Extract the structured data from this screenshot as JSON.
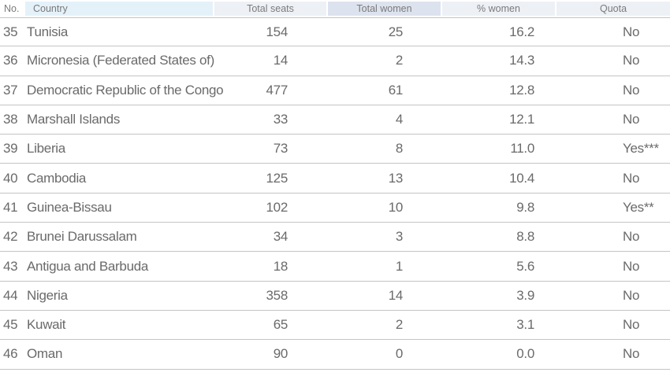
{
  "header": {
    "no": "No.",
    "country": "Country",
    "total_seats": "Total seats",
    "total_women": "Total women",
    "pct_women": "% women",
    "quota": "Quota"
  },
  "rows": [
    {
      "no": "35",
      "country": "Tunisia",
      "seats": "154",
      "women": "25",
      "pct": "16.2",
      "quota": "No"
    },
    {
      "no": "36",
      "country": "Micronesia (Federated States of)",
      "seats": "14",
      "women": "2",
      "pct": "14.3",
      "quota": "No"
    },
    {
      "no": "37",
      "country": "Democratic Republic of the Congo",
      "seats": "477",
      "women": "61",
      "pct": "12.8",
      "quota": "No"
    },
    {
      "no": "38",
      "country": "Marshall Islands",
      "seats": "33",
      "women": "4",
      "pct": "12.1",
      "quota": "No"
    },
    {
      "no": "39",
      "country": "Liberia",
      "seats": "73",
      "women": "8",
      "pct": "11.0",
      "quota": "Yes***"
    },
    {
      "no": "40",
      "country": "Cambodia",
      "seats": "125",
      "women": "13",
      "pct": "10.4",
      "quota": "No"
    },
    {
      "no": "41",
      "country": "Guinea-Bissau",
      "seats": "102",
      "women": "10",
      "pct": "9.8",
      "quota": "Yes**"
    },
    {
      "no": "42",
      "country": "Brunei Darussalam",
      "seats": "34",
      "women": "3",
      "pct": "8.8",
      "quota": "No"
    },
    {
      "no": "43",
      "country": "Antigua and Barbuda",
      "seats": "18",
      "women": "1",
      "pct": "5.6",
      "quota": "No"
    },
    {
      "no": "44",
      "country": "Nigeria",
      "seats": "358",
      "women": "14",
      "pct": "3.9",
      "quota": "No"
    },
    {
      "no": "45",
      "country": "Kuwait",
      "seats": "65",
      "women": "2",
      "pct": "3.1",
      "quota": "No"
    },
    {
      "no": "46",
      "country": "Oman",
      "seats": "90",
      "women": "0",
      "pct": "0.0",
      "quota": "No"
    }
  ]
}
